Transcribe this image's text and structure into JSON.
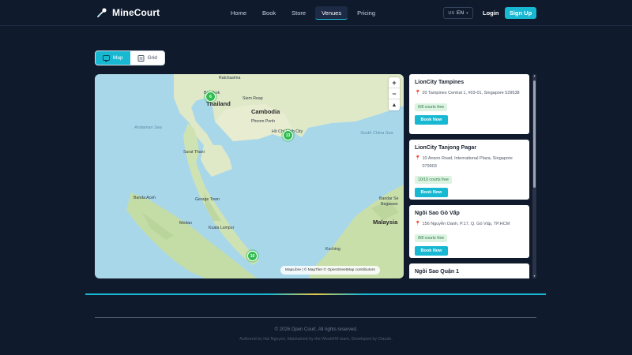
{
  "header": {
    "logo_text": "MineCourt",
    "nav": [
      {
        "label": "Home",
        "active": false
      },
      {
        "label": "Book",
        "active": false
      },
      {
        "label": "Store",
        "active": false
      },
      {
        "label": "Venues",
        "active": true
      },
      {
        "label": "Pricing",
        "active": false
      }
    ],
    "lang_flag": "US",
    "lang_code": "EN",
    "login_label": "Login",
    "signup_label": "Sign Up"
  },
  "view_toggle": {
    "map_label": "Map",
    "grid_label": "Grid",
    "active": "map"
  },
  "map": {
    "labels": {
      "ratchasima": "Ratchasima",
      "bangkok": "Bangkok",
      "thailand": "Thailand",
      "siem_reap": "Siem Reap",
      "cambodia": "Cambodia",
      "phnom_penh": "Phnom Penh",
      "ho_chi_minh": "Hồ Chí Minh City",
      "andaman_sea": "Andaman Sea",
      "south_china_sea": "South China Sea",
      "surat_thani": "Surat Thani",
      "banda_aceh": "Banda Aceh",
      "george_town": "George Town",
      "medan": "Medan",
      "kuala_lumpur": "Kuala Lumpur",
      "bandar_seri": "Bandar Se",
      "begawan": "Begawan",
      "malaysia": "Malaysia",
      "kuching": "Kuching"
    },
    "markers": {
      "bangkok_count": "6",
      "hcmc_count": "13",
      "singapore_count": "10"
    },
    "zoom_in": "+",
    "zoom_out": "−",
    "compass": "▲",
    "attribution": "MapLibre | © MapTiler © OpenStreetMap contributors"
  },
  "venues": [
    {
      "name": "LionCity Tampines",
      "address": "20 Tampines Central 1, #03-01, Singapore 529538",
      "courts": "6/8 courts free",
      "book_label": "Book Now"
    },
    {
      "name": "LionCity Tanjong Pagar",
      "address": "10 Anson Road, International Plaza, Singapore 079903",
      "courts": "10/10 courts free",
      "book_label": "Book Now"
    },
    {
      "name": "Ngôi Sao Gò Vấp",
      "address": "156 Nguyễn Oanh, P.17, Q. Gò Vấp, TP.HCM",
      "courts": "8/8 courts free",
      "book_label": "Book Now"
    },
    {
      "name": "Ngôi Sao Quận 1"
    }
  ],
  "footer": {
    "copyright": "© 2026 Open Court. All rights reserved.",
    "credits": "Authored by Hai Nguyen, Maintained by the WeebFM team, Developed by Claude."
  },
  "colors": {
    "background": "#0f1a2c",
    "accent": "#19b8d2",
    "marker": "#2ebd4e",
    "map_water": "#a9d7ea"
  }
}
